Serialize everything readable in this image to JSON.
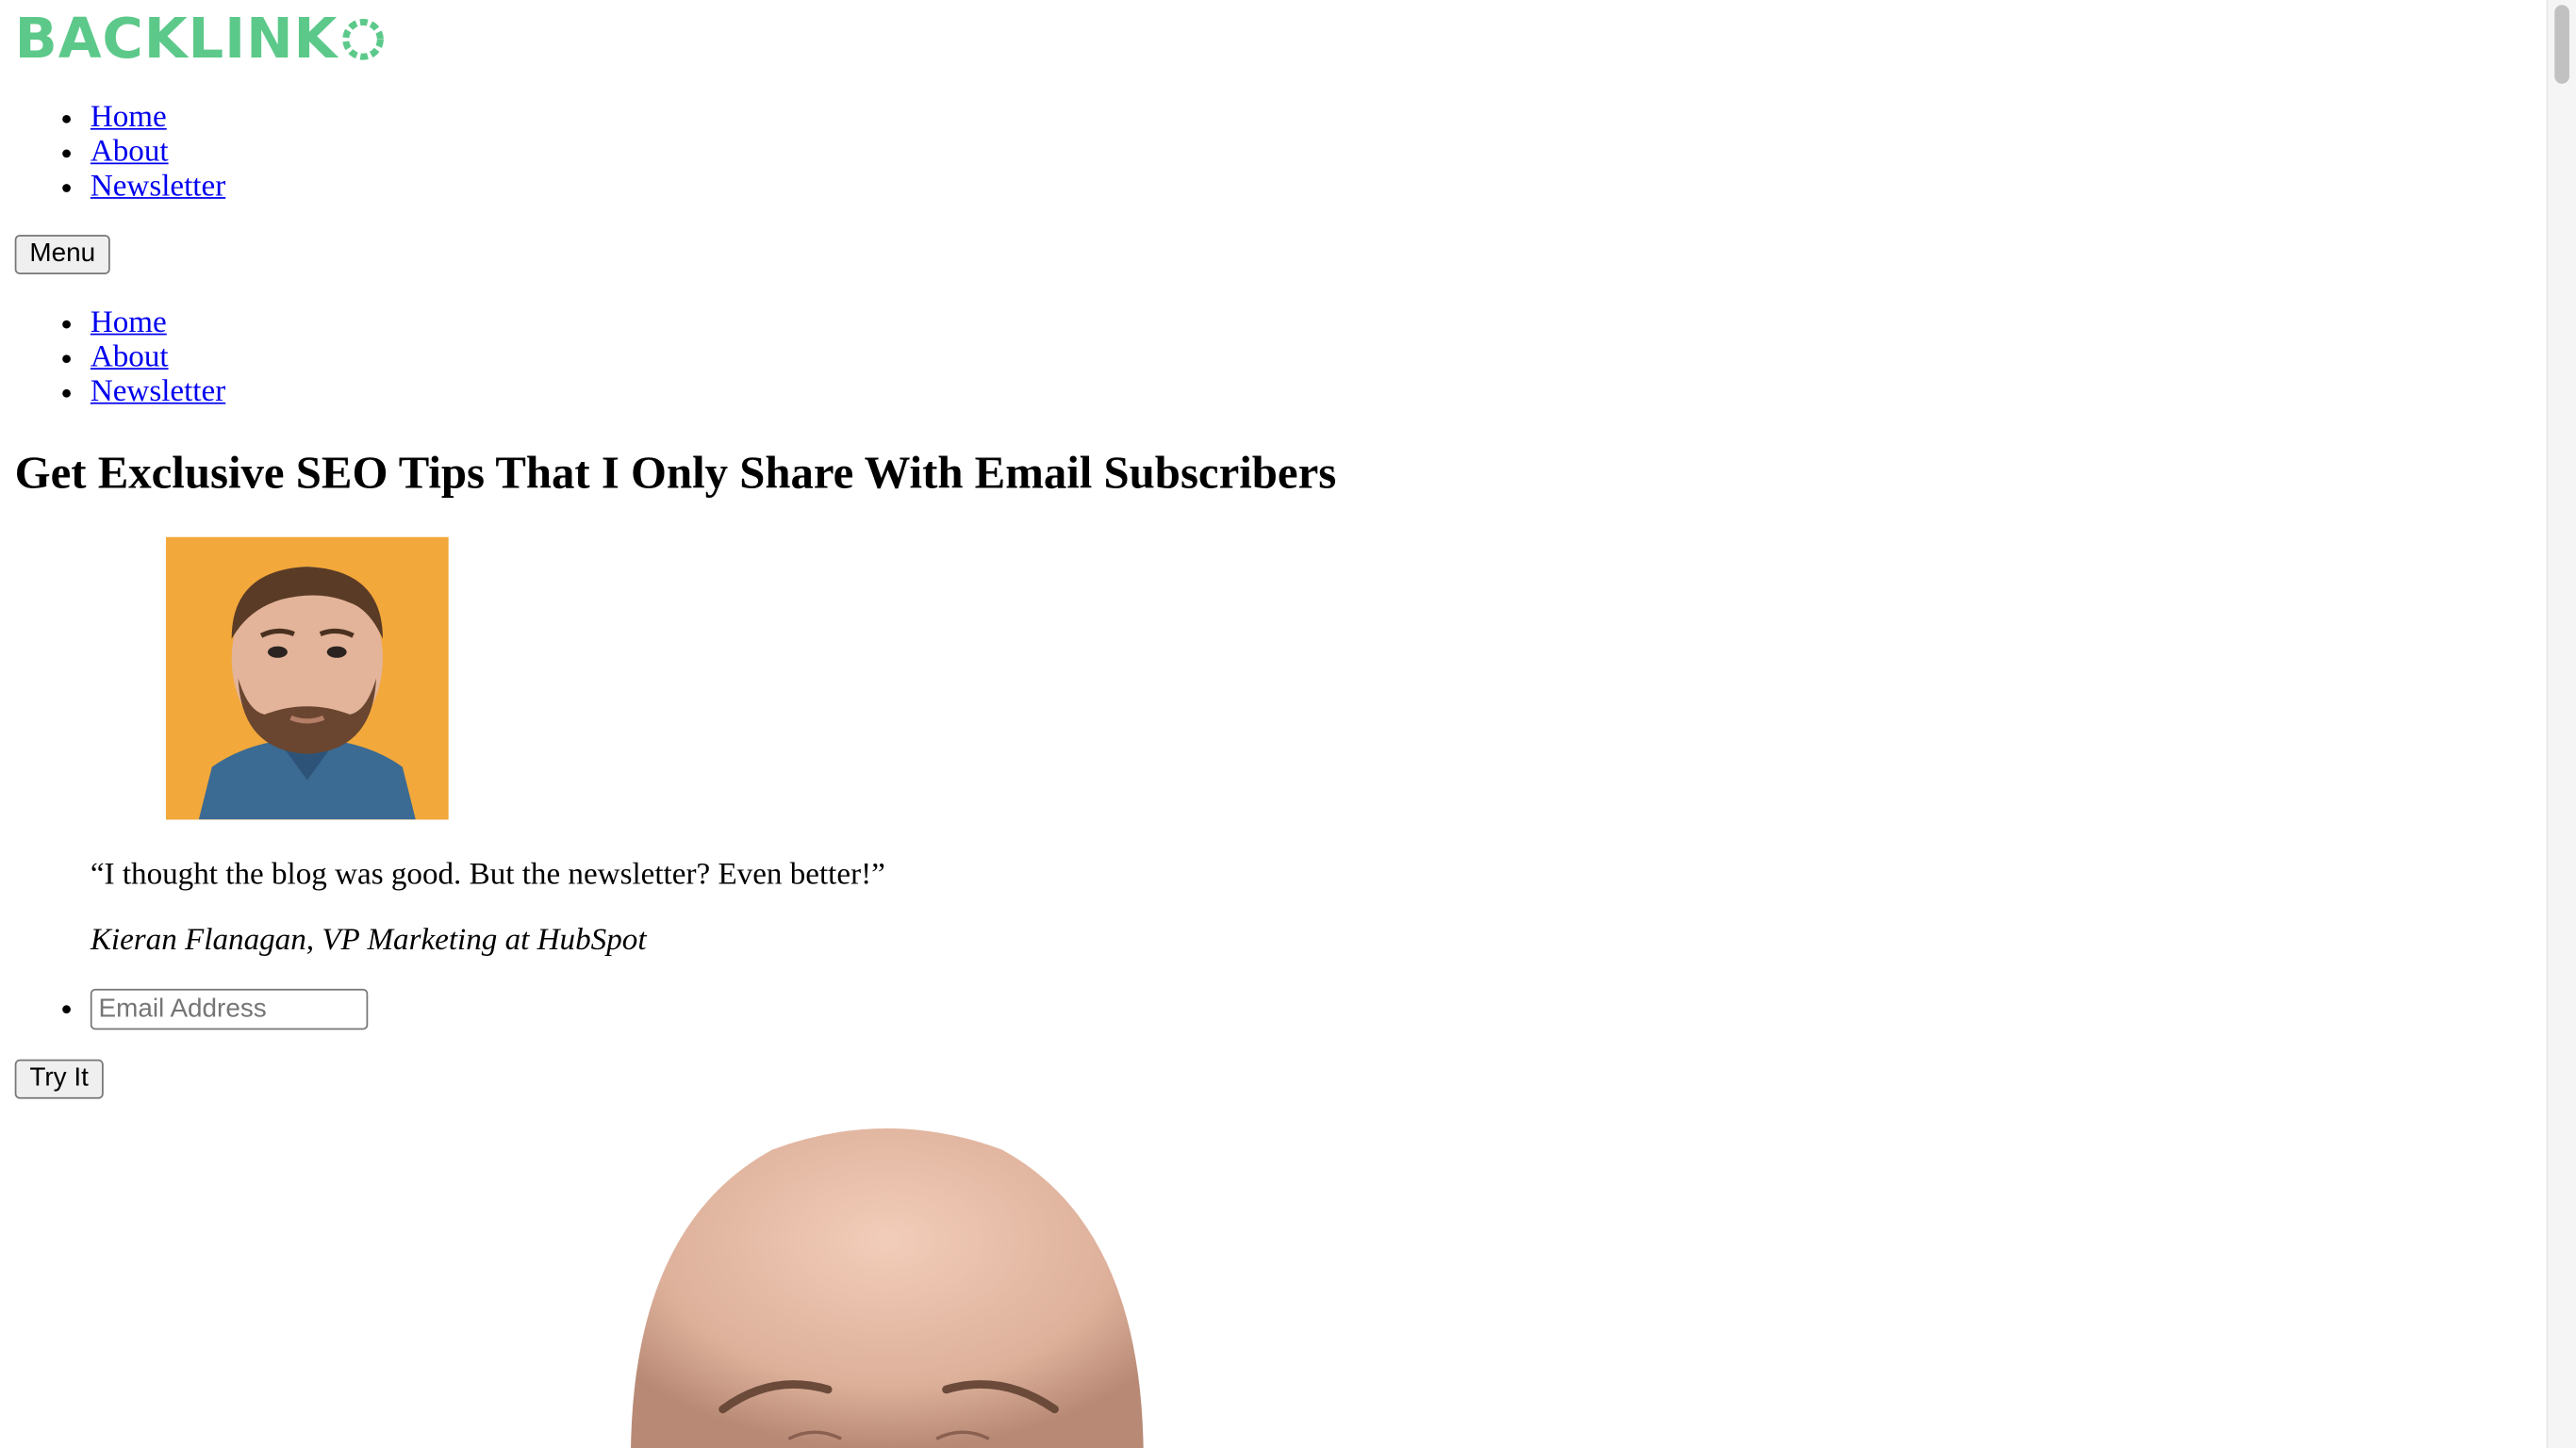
{
  "header": {
    "logo_text": "BACKLINK",
    "logo_color": "#5cc98a"
  },
  "nav_primary": {
    "items": [
      {
        "label": "Home"
      },
      {
        "label": "About"
      },
      {
        "label": "Newsletter"
      }
    ]
  },
  "menu_button_label": "Menu",
  "nav_mobile": {
    "items": [
      {
        "label": "Home"
      },
      {
        "label": "About"
      },
      {
        "label": "Newsletter"
      }
    ]
  },
  "headline": "Get Exclusive SEO Tips That I Only Share With Email Subscribers",
  "testimonial": {
    "quote": "“I thought the blog was good. But the newsletter? Even better!”",
    "author": "Kieran Flanagan, VP Marketing at HubSpot",
    "avatar_bg": "#f2a83a"
  },
  "signup": {
    "email_placeholder": "Email Address",
    "email_value": "",
    "submit_label": "Try It"
  },
  "colors": {
    "link": "#0000ee",
    "brand": "#5cc98a"
  }
}
